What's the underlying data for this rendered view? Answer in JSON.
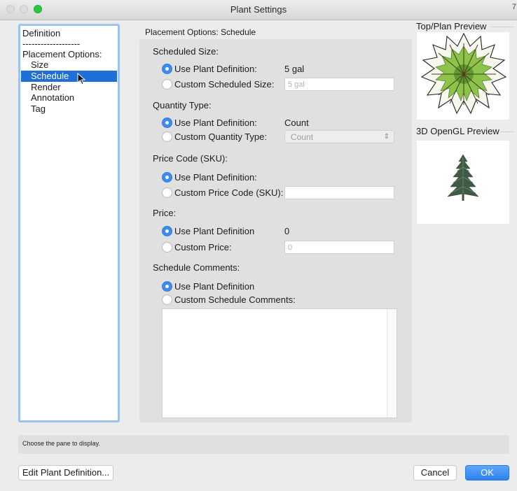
{
  "window": {
    "title": "Plant Settings",
    "corner_mark": "7"
  },
  "nav": {
    "items": [
      {
        "label": "Definition",
        "indent": false,
        "selected": false
      },
      {
        "label": "-------------------",
        "indent": false,
        "selected": false
      },
      {
        "label": "Placement Options:",
        "indent": false,
        "selected": false
      },
      {
        "label": "Size",
        "indent": true,
        "selected": false
      },
      {
        "label": "Schedule",
        "indent": true,
        "selected": true
      },
      {
        "label": "Render",
        "indent": true,
        "selected": false
      },
      {
        "label": "Annotation",
        "indent": true,
        "selected": false
      },
      {
        "label": "Tag",
        "indent": true,
        "selected": false
      }
    ]
  },
  "main": {
    "section_title": "Placement Options: Schedule",
    "scheduled_size": {
      "heading": "Scheduled Size:",
      "use_label": "Use Plant Definition:",
      "use_value": "5 gal",
      "custom_label": "Custom Scheduled Size:",
      "custom_value": "5 gal"
    },
    "quantity_type": {
      "heading": "Quantity Type:",
      "use_label": "Use Plant Definition:",
      "use_value": "Count",
      "custom_label": "Custom Quantity Type:",
      "custom_value": "Count"
    },
    "price_code": {
      "heading": "Price Code (SKU):",
      "use_label": "Use Plant Definition:",
      "custom_label": "Custom Price Code (SKU):",
      "custom_value": ""
    },
    "price": {
      "heading": "Price:",
      "use_label": "Use Plant Definition",
      "use_value": "0",
      "custom_label": "Custom Price:",
      "custom_value": "0"
    },
    "schedule_comments": {
      "heading": "Schedule Comments:",
      "use_label": "Use Plant Definition",
      "custom_label": "Custom Schedule Comments:",
      "value": ""
    }
  },
  "previews": {
    "top_plan_title": "Top/Plan Preview",
    "opengl_title": "3D OpenGL Preview"
  },
  "status_text": "Choose the pane to display.",
  "buttons": {
    "edit": "Edit Plant Definition...",
    "cancel": "Cancel",
    "ok": "OK"
  },
  "colors": {
    "accent": "#1f6fd6",
    "radio_on": "#3b8bf0",
    "nav_border": "#9cc3ef"
  }
}
